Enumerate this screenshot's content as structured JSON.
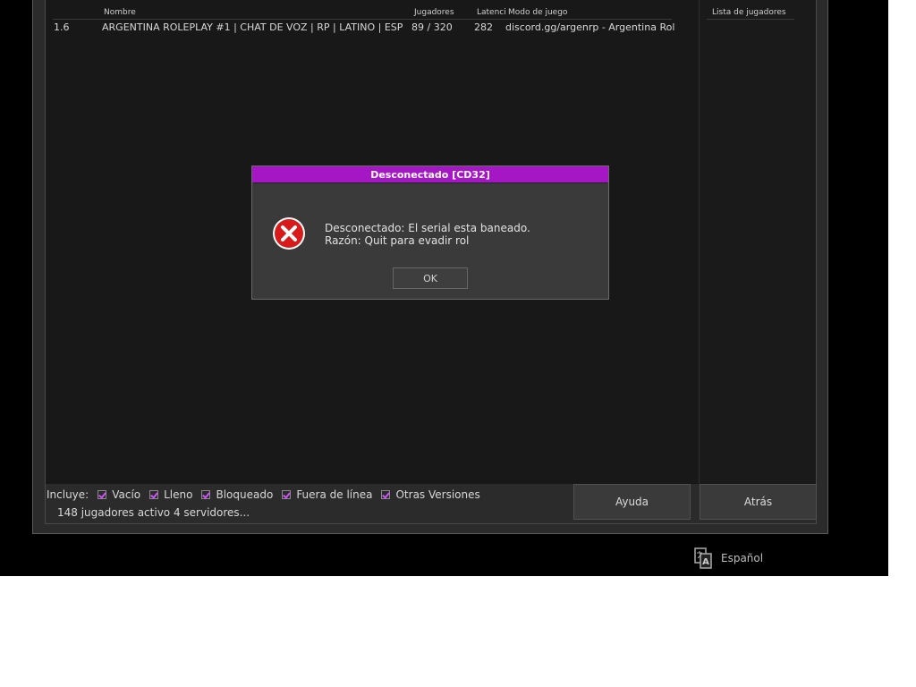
{
  "server_list": {
    "columns": {
      "name": "Nombre",
      "players": "Jugadores",
      "latency": "Latenci",
      "gamemode": "Modo de juego"
    },
    "rows": [
      {
        "version": "1.6",
        "name": "ARGENTINA ROLEPLAY #1 | CHAT DE VOZ | RP | LATINO | ESP",
        "players": "89 / 320",
        "latency": "282",
        "gamemode": "discord.gg/argenrp - Argentina Rol"
      }
    ]
  },
  "players_panel": {
    "header": "Lista de jugadores"
  },
  "filters": {
    "label": "Incluye:",
    "items": [
      {
        "label": "Vacío",
        "checked": true
      },
      {
        "label": "Lleno",
        "checked": true
      },
      {
        "label": "Bloqueado",
        "checked": true
      },
      {
        "label": "Fuera de línea",
        "checked": true
      },
      {
        "label": "Otras Versiones",
        "checked": true
      }
    ]
  },
  "status": "148 jugadores activo 4 servidores...",
  "buttons": {
    "help": "Ayuda",
    "back": "Atrás"
  },
  "language": {
    "label": "Español",
    "icon": "language-icon"
  },
  "dialog": {
    "title": "Desconectado [CD32]",
    "icon": "error-icon",
    "line1": "Desconectado: El serial esta baneado.",
    "line2": "Razón: Quit para evadir rol",
    "ok_label": "OK"
  },
  "colors": {
    "accent": "#a516c4",
    "check": "#d050ff",
    "error": "#d91a1a"
  }
}
